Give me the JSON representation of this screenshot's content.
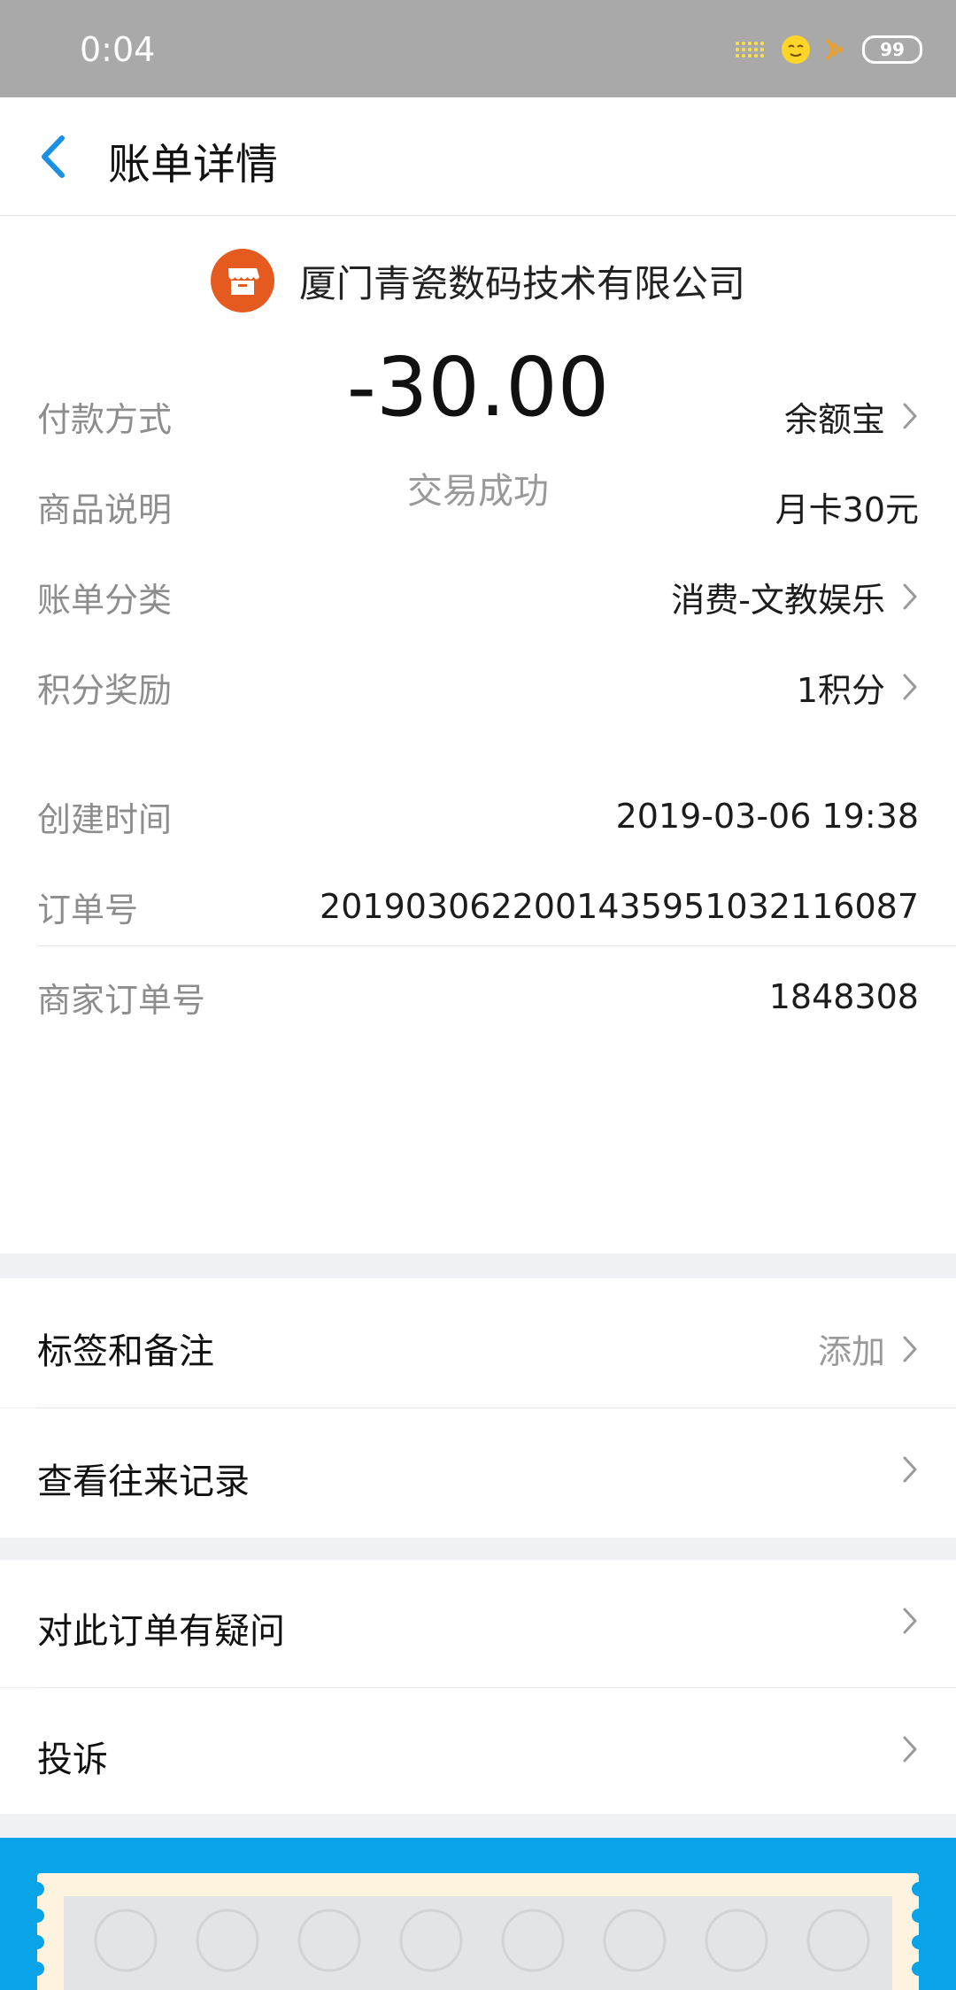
{
  "status_bar": {
    "time": "0:04",
    "battery": "99",
    "icons": [
      "signal-dots-icon",
      "emoji-face-icon",
      "wifi-icon",
      "battery-icon"
    ]
  },
  "nav": {
    "back_icon": "back-chevron-icon",
    "title": "账单详情"
  },
  "merchant": {
    "icon": "storefront-icon",
    "name": "厦门青瓷数码技术有限公司"
  },
  "amount": "-30.00",
  "status": "交易成功",
  "details_top": [
    {
      "label": "付款方式",
      "value": "余额宝",
      "has_chevron": true
    },
    {
      "label": "商品说明",
      "value": "月卡30元",
      "has_chevron": false
    },
    {
      "label": "账单分类",
      "value": "消费-文教娱乐",
      "has_chevron": true
    },
    {
      "label": "积分奖励",
      "value": "1积分",
      "has_chevron": true
    }
  ],
  "details_bottom": [
    {
      "label": "创建时间",
      "value": "2019-03-06 19:38"
    },
    {
      "label": "订单号",
      "value": "2019030622001435951032116087"
    },
    {
      "label": "商家订单号",
      "value": "1848308"
    }
  ],
  "actions": {
    "tags_notes": {
      "label": "标签和备注",
      "action": "添加"
    },
    "history": {
      "label": "查看往来记录"
    },
    "question": {
      "label": "对此订单有疑问"
    },
    "complaint": {
      "label": "投诉"
    }
  },
  "colors": {
    "accent_blue": "#1a8fe3",
    "merchant_orange": "#e55a1f",
    "promo_blue": "#09a3e8"
  }
}
